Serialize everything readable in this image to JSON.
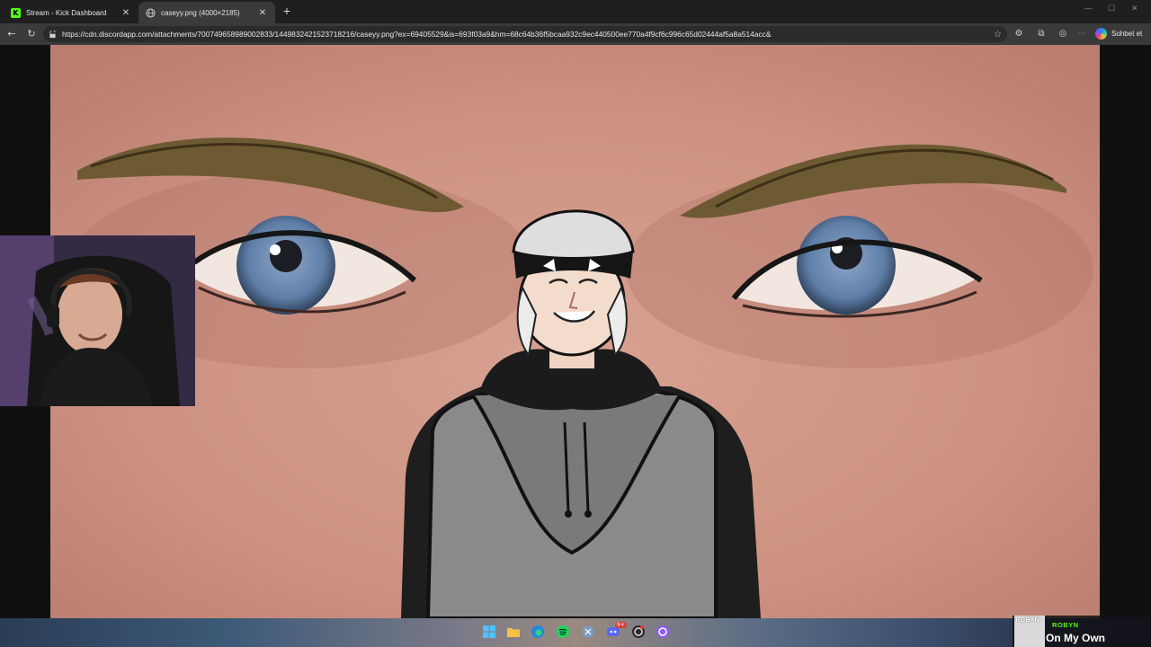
{
  "tabs": [
    {
      "label": "Stream - Kick Dashboard",
      "favicon": "kick-logo-icon",
      "active": false
    },
    {
      "label": "caseyy.png (4000×2185)",
      "favicon": "globe-icon",
      "active": true
    }
  ],
  "favicon_glyph": "K",
  "new_tab_glyph": "+",
  "address_bar": {
    "url": "https://cdn.discordapp.com/attachments/700749658989002833/1449832421523718216/caseyy.png?ex=69405529&is=693f03a9&hm=68c64b36f5bcaa932c9ec440500ee770a4f9cf6c996c65d02444af5a8a514acc&"
  },
  "toolbar_icons": [
    "back-arrow-icon",
    "reload-icon",
    "star-icon",
    "extensions-icon",
    "puzzle-icon",
    "profile-icon"
  ],
  "copilot": {
    "label": "Sohbet et"
  },
  "taskbar": {
    "apps": [
      "windows-start-icon",
      "file-explorer-icon",
      "edge-browser-icon",
      "spotify-icon",
      "snipping-tool-icon",
      "discord-icon",
      "obs-icon",
      "twitch-icon"
    ],
    "discord_badge": "9+"
  },
  "now_playing": {
    "album_text": "ROBYN",
    "artist": "ROBYN",
    "title": "On My Own"
  },
  "colors": {
    "kick_green": "#53fc18",
    "tab_bg": "#1f1f1f",
    "toolbar_bg": "#3a3a3a"
  }
}
